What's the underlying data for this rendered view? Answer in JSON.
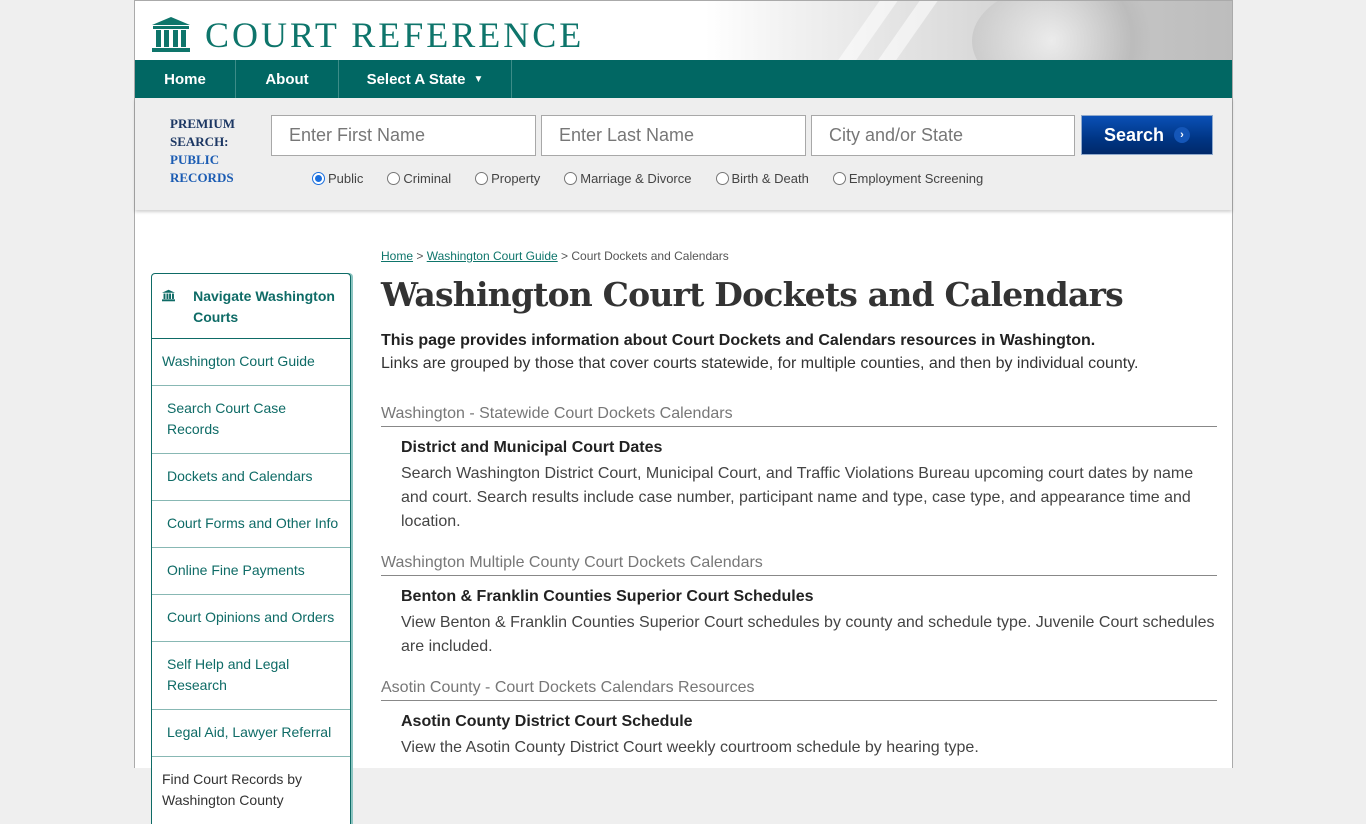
{
  "site": {
    "logo_text": "COURT REFERENCE"
  },
  "nav": {
    "home": "Home",
    "about": "About",
    "select_state": "Select A State",
    "caret": "▼"
  },
  "search": {
    "premium_line1": "PREMIUM",
    "premium_line2": "SEARCH:",
    "premium_line3": "PUBLIC",
    "premium_line4": "RECORDS",
    "first_name_placeholder": "Enter First Name",
    "last_name_placeholder": "Enter Last Name",
    "city_state_placeholder": "City and/or State",
    "button_label": "Search",
    "button_icon": "›",
    "options": [
      {
        "label": "Public",
        "selected": true
      },
      {
        "label": "Criminal",
        "selected": false
      },
      {
        "label": "Property",
        "selected": false
      },
      {
        "label": "Marriage & Divorce",
        "selected": false
      },
      {
        "label": "Birth & Death",
        "selected": false
      },
      {
        "label": "Employment Screening",
        "selected": false
      }
    ]
  },
  "sidebar": {
    "title": "Navigate Washington Courts",
    "items": [
      "Washington Court Guide",
      "Search Court Case Records",
      "Dockets and Calendars",
      "Court Forms and Other Info",
      "Online Fine Payments",
      "Court Opinions and Orders",
      "Self Help and Legal Research",
      "Legal Aid, Lawyer Referral",
      "Find Court Records by Washington County"
    ]
  },
  "breadcrumb": {
    "home": "Home",
    "sep": ">",
    "guide": "Washington Court Guide",
    "current": "Court Dockets and Calendars"
  },
  "page": {
    "title": "Washington Court Dockets and Calendars",
    "intro_bold": "This page provides information about Court Dockets and Calendars resources in Washington.",
    "intro": "Links are grouped by those that cover courts statewide, for multiple counties, and then by individual county."
  },
  "sections": [
    {
      "heading": "Washington - Statewide Court Dockets Calendars",
      "resources": [
        {
          "title": "District and Municipal Court Dates",
          "desc": "Search Washington District Court, Municipal Court, and Traffic Violations Bureau upcoming court dates by name and court. Search results include case number, participant name and type, case type, and appearance time and location."
        }
      ]
    },
    {
      "heading": "Washington Multiple County Court Dockets Calendars",
      "resources": [
        {
          "title": "Benton & Franklin Counties Superior Court Schedules",
          "desc": "View Benton & Franklin Counties Superior Court schedules by county and schedule type. Juvenile Court schedules are included."
        }
      ]
    },
    {
      "heading": "Asotin County - Court Dockets Calendars Resources",
      "resources": [
        {
          "title": "Asotin County District Court Schedule",
          "desc": "View the Asotin County District Court weekly courtroom schedule by hearing type."
        }
      ]
    }
  ]
}
